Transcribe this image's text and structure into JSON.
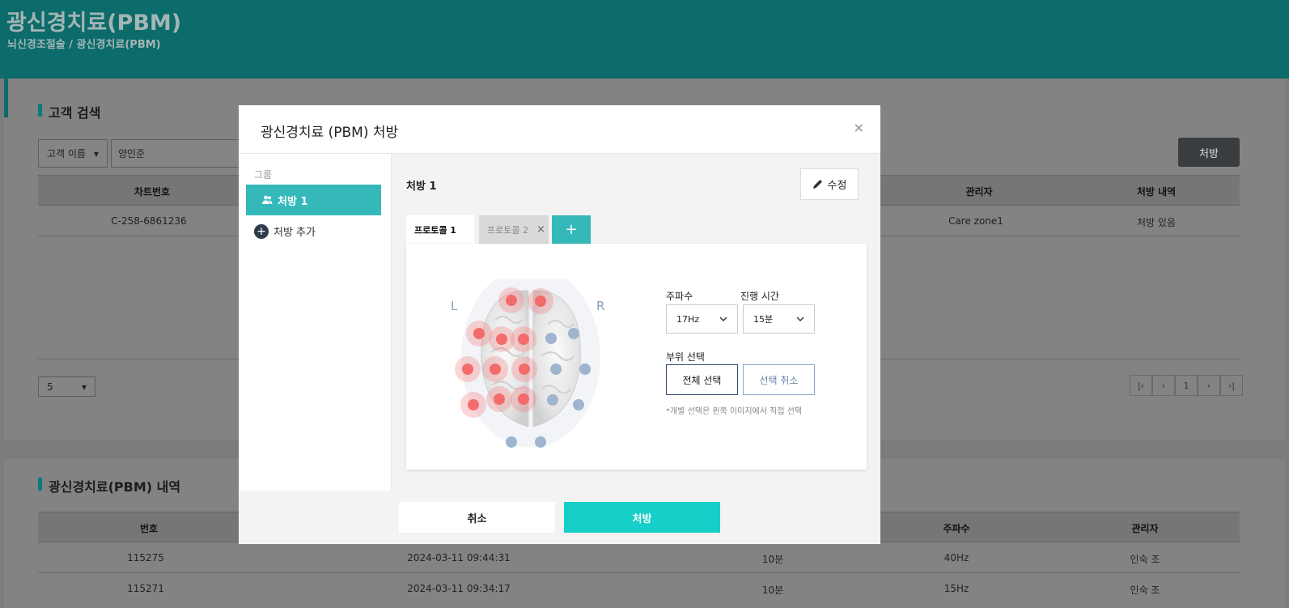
{
  "header": {
    "title": "광신경치료(PBM)",
    "breadcrumb": "뇌신경조절술 / 광신경치료(PBM)"
  },
  "search": {
    "section_title": "고객 검색",
    "field_select": "고객 이름",
    "query_value": "양인준",
    "prescribe_button": "처방",
    "columns": [
      "차트번호",
      "관리자",
      "처방 내역"
    ],
    "row": {
      "chart_no": "C-258-6861236",
      "manager": "Care zone1",
      "history": "처방 있음"
    },
    "page_size": "5",
    "pager": {
      "first": "|‹",
      "prev": "‹",
      "current": "1",
      "next": "›",
      "last": "›|"
    }
  },
  "history": {
    "section_title": "광신경치료(PBM) 내역",
    "columns": [
      "번호",
      "주파수",
      "관리자"
    ],
    "rows": [
      {
        "no": "115275",
        "datetime": "2024-03-11 09:44:31",
        "duration": "10분",
        "freq": "40Hz",
        "manager": "인숙 조"
      },
      {
        "no": "115271",
        "datetime": "2024-03-11 09:34:17",
        "duration": "10분",
        "freq": "15Hz",
        "manager": "인숙 조"
      }
    ]
  },
  "modal": {
    "title": "광신경치료 (PBM) 처방",
    "close": "×",
    "sidebar": {
      "group_label": "그룹",
      "active_item": "처방 1",
      "add_item": "처방 추가"
    },
    "prescription_title": "처방 1",
    "edit_button": "수정",
    "tabs": [
      {
        "label": "프로토콜 1"
      },
      {
        "label": "프로토콜 2",
        "close": "×"
      }
    ],
    "add_tab": "+",
    "brain": {
      "left_label": "L",
      "right_label": "R"
    },
    "frequency": {
      "label": "주파수",
      "value": "17Hz"
    },
    "duration": {
      "label": "진행 시간",
      "value": "15분"
    },
    "region": {
      "label": "부위 선택",
      "select_all": "전체 선택",
      "deselect": "선택 취소"
    },
    "hint": "*개별 선택은 왼쪽 이미지에서 직접 선택",
    "footer": {
      "cancel": "취소",
      "confirm": "처방"
    }
  },
  "colors": {
    "teal_dark": "#0c6b6b",
    "teal": "#34b8b9",
    "confirm": "#15cfc8",
    "point_active": "#f46b6b",
    "point_inactive": "#9fb4cf"
  },
  "brain_points": {
    "active_count": 12,
    "inactive_count": 8
  }
}
